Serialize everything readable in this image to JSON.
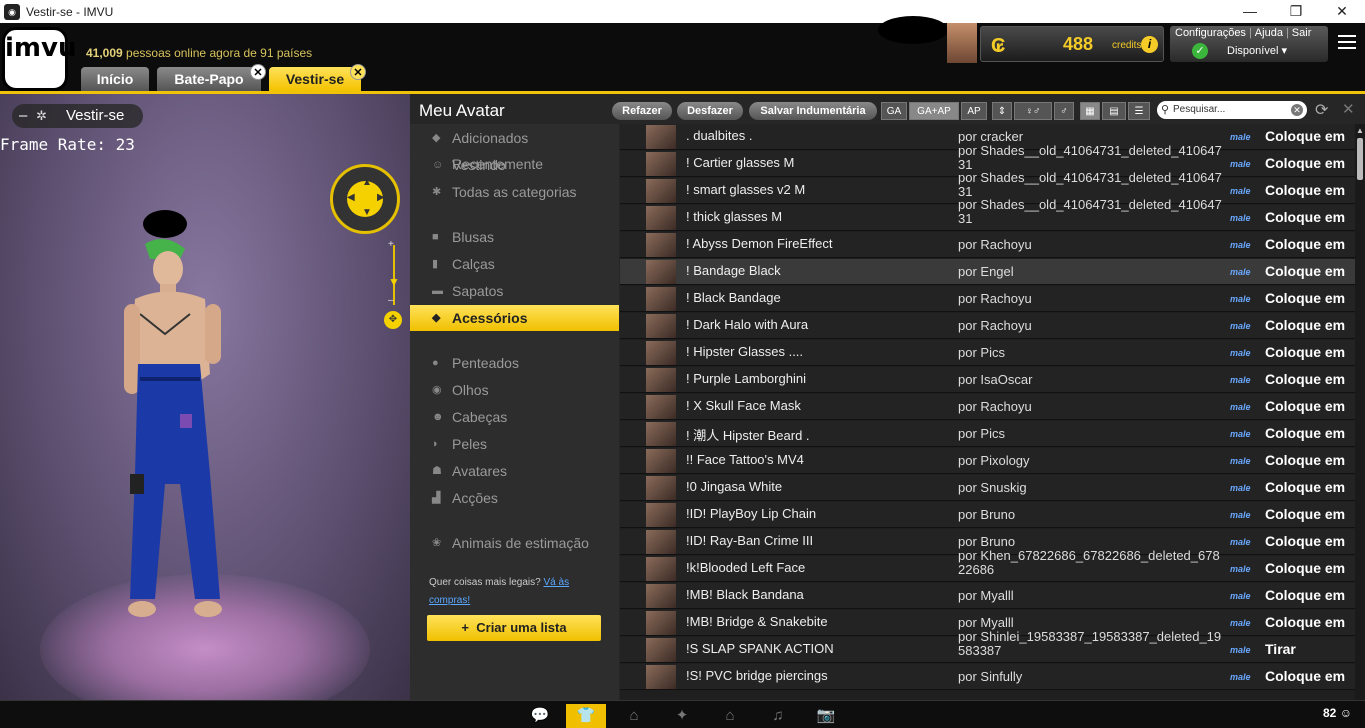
{
  "window": {
    "title": "Vestir-se - IMVU",
    "icon": "imvu-app-icon",
    "controls": [
      "minimize",
      "maximize",
      "close"
    ]
  },
  "header": {
    "logo_text": "imvu",
    "online_count": "41,009",
    "online_text": "pessoas online agora de 91 países",
    "tabs": [
      {
        "label": "Início",
        "active": false,
        "closable": false
      },
      {
        "label": "Bate-Papo",
        "active": false,
        "closable": true
      },
      {
        "label": "Vestir-se",
        "active": true,
        "closable": true
      }
    ],
    "credits": {
      "amount": "488",
      "label": "credits",
      "symbol": "₢",
      "info": "i"
    },
    "menu": {
      "settings": "Configurações",
      "help": "Ajuda",
      "logout": "Sair",
      "status": "Disponível"
    }
  },
  "viewport": {
    "label": "Vestir-se",
    "frame_rate": "Frame Rate: 23"
  },
  "main": {
    "title": "Meu Avatar",
    "toolbar": {
      "redo": "Refazer",
      "undo": "Desfazer",
      "save": "Salvar Indumentária",
      "filters": [
        "GA",
        "GA+AP",
        "AP"
      ],
      "active_filter": "GA+AP",
      "search_placeholder": "Pesquisar..."
    },
    "categories": [
      {
        "label": "Adicionados Recentemente",
        "icon": "tag-icon",
        "active": false
      },
      {
        "label": "Vestindo",
        "icon": "person-icon",
        "active": false
      },
      {
        "label": "Todas as categorias",
        "icon": "asterisk-icon",
        "active": false
      },
      {
        "label": "Blusas",
        "icon": "shirt-icon",
        "active": false
      },
      {
        "label": "Calças",
        "icon": "pants-icon",
        "active": false
      },
      {
        "label": "Sapatos",
        "icon": "shoe-icon",
        "active": false
      },
      {
        "label": "Acessórios",
        "icon": "gem-icon",
        "active": true
      },
      {
        "label": "Penteados",
        "icon": "hair-icon",
        "active": false
      },
      {
        "label": "Olhos",
        "icon": "eye-icon",
        "active": false
      },
      {
        "label": "Cabeças",
        "icon": "head-icon",
        "active": false
      },
      {
        "label": "Peles",
        "icon": "lips-icon",
        "active": false
      },
      {
        "label": "Avatares",
        "icon": "user-icon",
        "active": false
      },
      {
        "label": "Acções",
        "icon": "action-icon",
        "active": false
      },
      {
        "label": "Animais de estimação",
        "icon": "paw-icon",
        "active": false
      }
    ],
    "promo": {
      "text": "Quer coisas mais legais?",
      "link": "Vá às compras!"
    },
    "create_list": "Criar uma lista",
    "items": [
      {
        "name": ". dualbites .",
        "creator": "por cracker",
        "gender": "male",
        "action": "Coloque em"
      },
      {
        "name": "! Cartier glasses M",
        "creator": "por Shades__old_41064731_deleted_41064731",
        "gender": "male",
        "action": "Coloque em"
      },
      {
        "name": "! smart glasses v2 M",
        "creator": "por Shades__old_41064731_deleted_41064731",
        "gender": "male",
        "action": "Coloque em"
      },
      {
        "name": "! thick glasses M",
        "creator": "por Shades__old_41064731_deleted_41064731",
        "gender": "male",
        "action": "Coloque em"
      },
      {
        "name": "! Abyss Demon FireEffect",
        "creator": "por Rachoyu",
        "gender": "male",
        "action": "Coloque em"
      },
      {
        "name": "! Bandage Black",
        "creator": "por Engel",
        "gender": "male",
        "action": "Coloque em"
      },
      {
        "name": "! Black Bandage",
        "creator": "por Rachoyu",
        "gender": "male",
        "action": "Coloque em"
      },
      {
        "name": "! Dark Halo with Aura",
        "creator": "por Rachoyu",
        "gender": "male",
        "action": "Coloque em"
      },
      {
        "name": "! Hipster Glasses ....",
        "creator": "por Pics",
        "gender": "male",
        "action": "Coloque em"
      },
      {
        "name": "! Purple Lamborghini",
        "creator": "por IsaOscar",
        "gender": "male",
        "action": "Coloque em"
      },
      {
        "name": "! X Skull Face Mask",
        "creator": "por Rachoyu",
        "gender": "male",
        "action": "Coloque em"
      },
      {
        "name": "! 潮人 Hipster Beard .",
        "creator": "por Pics",
        "gender": "male",
        "action": "Coloque em"
      },
      {
        "name": "!! Face Tattoo's MV4",
        "creator": "por Pixology",
        "gender": "male",
        "action": "Coloque em"
      },
      {
        "name": "!0 Jingasa White",
        "creator": "por Snuskig",
        "gender": "male",
        "action": "Coloque em"
      },
      {
        "name": "!ID! PlayBoy Lip Chain",
        "creator": "por Bruno",
        "gender": "male",
        "action": "Coloque em"
      },
      {
        "name": "!ID! Ray-Ban Crime III",
        "creator": "por Bruno",
        "gender": "male",
        "action": "Coloque em"
      },
      {
        "name": "!k!Blooded Left Face",
        "creator": "por Khen_67822686_67822686_deleted_67822686",
        "gender": "male",
        "action": "Coloque em"
      },
      {
        "name": "!MB! Black Bandana",
        "creator": "por Myalll",
        "gender": "male",
        "action": "Coloque em"
      },
      {
        "name": "!MB! Bridge & Snakebite",
        "creator": "por Myalll",
        "gender": "male",
        "action": "Coloque em"
      },
      {
        "name": "!S SLAP SPANK ACTION",
        "creator": "por Shinlei_19583387_19583387_deleted_19583387",
        "gender": "male",
        "action": "Tirar"
      },
      {
        "name": "!S! PVC bridge piercings",
        "creator": "por Sinfully",
        "gender": "male",
        "action": "Coloque em"
      }
    ]
  },
  "bottombar": {
    "count": "82"
  }
}
